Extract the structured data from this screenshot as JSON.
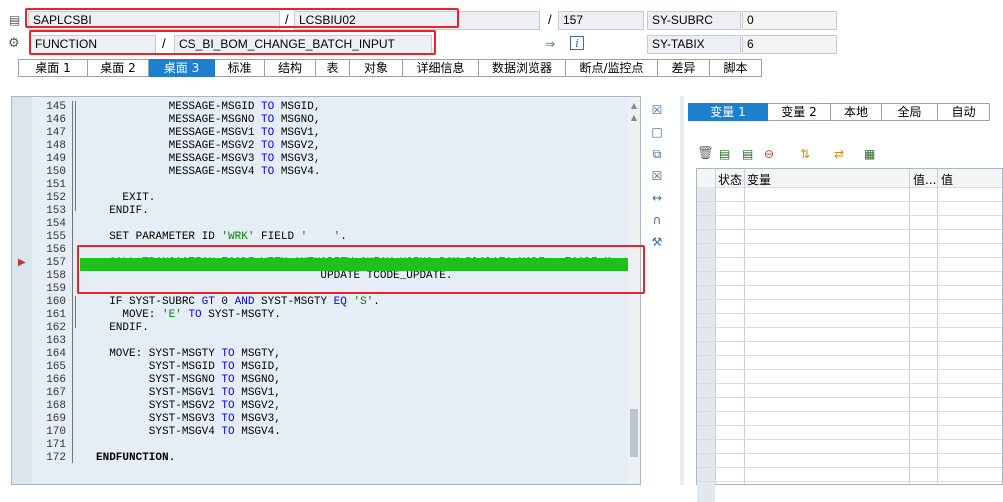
{
  "header": {
    "program": "SAPLCSBI",
    "include": "LCSBIU02",
    "line_no": "157",
    "sy_field1": "SY-SUBRC",
    "sy_value1": "0",
    "event_type": "FUNCTION",
    "event_name": "CS_BI_BOM_CHANGE_BATCH_INPUT",
    "sy_field2": "SY-TABIX",
    "sy_value2": "6",
    "slash": "/"
  },
  "main_tabs": [
    {
      "label": "桌面 1"
    },
    {
      "label": "桌面 2"
    },
    {
      "label": "桌面 3"
    },
    {
      "label": "标准"
    },
    {
      "label": "结构"
    },
    {
      "label": "表"
    },
    {
      "label": "对象"
    },
    {
      "label": "详细信息"
    },
    {
      "label": "数据浏览器"
    },
    {
      "label": "断点/监控点"
    },
    {
      "label": "差异"
    },
    {
      "label": "脚本"
    }
  ],
  "active_tab": "桌面 3",
  "code_lines": [
    {
      "n": "145",
      "t": "           MESSAGE-MSGID TO MSGID,"
    },
    {
      "n": "146",
      "t": "           MESSAGE-MSGNO TO MSGNO,"
    },
    {
      "n": "147",
      "t": "           MESSAGE-MSGV1 TO MSGV1,"
    },
    {
      "n": "148",
      "t": "           MESSAGE-MSGV2 TO MSGV2,"
    },
    {
      "n": "149",
      "t": "           MESSAGE-MSGV3 TO MSGV3,"
    },
    {
      "n": "150",
      "t": "           MESSAGE-MSGV4 TO MSGV4."
    },
    {
      "n": "151",
      "t": ""
    },
    {
      "n": "152",
      "t": "    EXIT."
    },
    {
      "n": "153",
      "t": "  ENDIF."
    },
    {
      "n": "154",
      "t": ""
    },
    {
      "n": "155",
      "t": "  SET PARAMETER ID 'WRK' FIELD '    '."
    },
    {
      "n": "156",
      "t": ""
    },
    {
      "n": "157",
      "t": "  CALL TRANSACTION TCODE WITH AUTHORITY-CHECK USING BOM_BDCDATA MODE   TCODE_M"
    },
    {
      "n": "158",
      "t": "                                  UPDATE TCODE_UPDATE."
    },
    {
      "n": "159",
      "t": ""
    },
    {
      "n": "160",
      "t": "  IF SYST-SUBRC GT 0 AND SYST-MSGTY EQ 'S'."
    },
    {
      "n": "161",
      "t": "    MOVE: 'E' TO SYST-MSGTY."
    },
    {
      "n": "162",
      "t": "  ENDIF."
    },
    {
      "n": "163",
      "t": ""
    },
    {
      "n": "164",
      "t": "  MOVE: SYST-MSGTY TO MSGTY,"
    },
    {
      "n": "165",
      "t": "        SYST-MSGID TO MSGID,"
    },
    {
      "n": "166",
      "t": "        SYST-MSGNO TO MSGNO,"
    },
    {
      "n": "167",
      "t": "        SYST-MSGV1 TO MSGV1,"
    },
    {
      "n": "168",
      "t": "        SYST-MSGV2 TO MSGV2,"
    },
    {
      "n": "169",
      "t": "        SYST-MSGV3 TO MSGV3,"
    },
    {
      "n": "170",
      "t": "        SYST-MSGV4 TO MSGV4."
    },
    {
      "n": "171",
      "t": ""
    },
    {
      "n": "172",
      "t": "ENDFUNCTION."
    }
  ],
  "right_tabs": [
    {
      "label": "变量 1"
    },
    {
      "label": "变量 2"
    },
    {
      "label": "本地"
    },
    {
      "label": "全局"
    },
    {
      "label": "自动"
    }
  ],
  "var_columns": {
    "status": "状态",
    "variable": "变量",
    "value_trunc": "值...",
    "value": "值"
  },
  "colors": {
    "accent": "#1e7fcf",
    "highlight": "#1ec01e",
    "callout": "#e8262a",
    "keyword": "#0000ff",
    "string": "#008800"
  }
}
